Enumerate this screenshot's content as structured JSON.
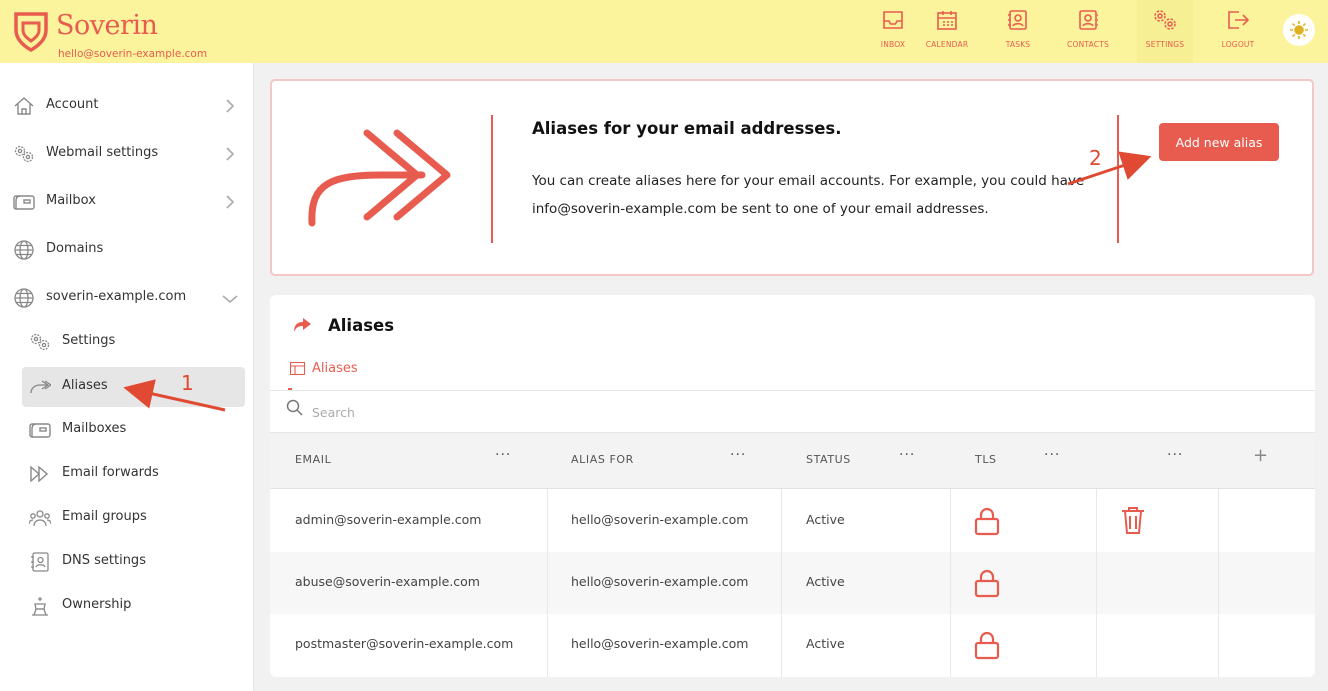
{
  "app": {
    "brand": "Soverin",
    "user_email": "hello@soverin-example.com"
  },
  "topnav": [
    {
      "label": "INBOX",
      "icon": "inbox-icon"
    },
    {
      "label": "CALENDAR",
      "icon": "calendar-icon"
    },
    {
      "label": "TASKS",
      "icon": "tasks-icon"
    },
    {
      "label": "CONTACTS",
      "icon": "contacts-icon"
    },
    {
      "label": "SETTINGS",
      "icon": "settings-icon",
      "active": true
    },
    {
      "label": "LOGOUT",
      "icon": "logout-icon"
    }
  ],
  "sidebar": {
    "items": [
      {
        "label": "Account",
        "icon": "home-icon"
      },
      {
        "label": "Webmail settings",
        "icon": "gears-icon"
      },
      {
        "label": "Mailbox",
        "icon": "mailbox-icon"
      },
      {
        "label": "Domains",
        "icon": "globe-icon"
      },
      {
        "label": "soverin-example.com",
        "icon": "globe-icon",
        "expanded": true
      }
    ],
    "subitems": [
      {
        "label": "Settings",
        "icon": "gears-icon"
      },
      {
        "label": "Aliases",
        "icon": "alias-arrow-icon",
        "active": true
      },
      {
        "label": "Mailboxes",
        "icon": "mailbox-icon"
      },
      {
        "label": "Email forwards",
        "icon": "forward-icon"
      },
      {
        "label": "Email groups",
        "icon": "group-icon"
      },
      {
        "label": "DNS settings",
        "icon": "dns-icon"
      },
      {
        "label": "Ownership",
        "icon": "ownership-icon"
      }
    ]
  },
  "info": {
    "title": "Aliases for your email addresses.",
    "description": "You can create aliases here for your email accounts. For example, you could have info@soverin-example.com be sent to one of your email addresses.",
    "add_button": "Add new alias"
  },
  "aliases": {
    "title": "Aliases",
    "tab_label": "Aliases",
    "search_placeholder": "Search",
    "columns": [
      "EMAIL",
      "ALIAS FOR",
      "STATUS",
      "TLS"
    ],
    "column_menu": "···",
    "add_column": "+",
    "rows": [
      {
        "email": "admin@soverin-example.com",
        "alias_for": "hello@soverin-example.com",
        "status": "Active",
        "tls": "lock-icon",
        "deletable": true
      },
      {
        "email": "abuse@soverin-example.com",
        "alias_for": "hello@soverin-example.com",
        "status": "Active",
        "tls": "lock-icon",
        "deletable": false
      },
      {
        "email": "postmaster@soverin-example.com",
        "alias_for": "hello@soverin-example.com",
        "status": "Active",
        "tls": "lock-icon",
        "deletable": false
      }
    ]
  },
  "annotations": [
    "1",
    "2"
  ],
  "colors": {
    "accent": "#e85c4f",
    "header_bg": "#fcf49c",
    "annotation": "#e04a32"
  }
}
